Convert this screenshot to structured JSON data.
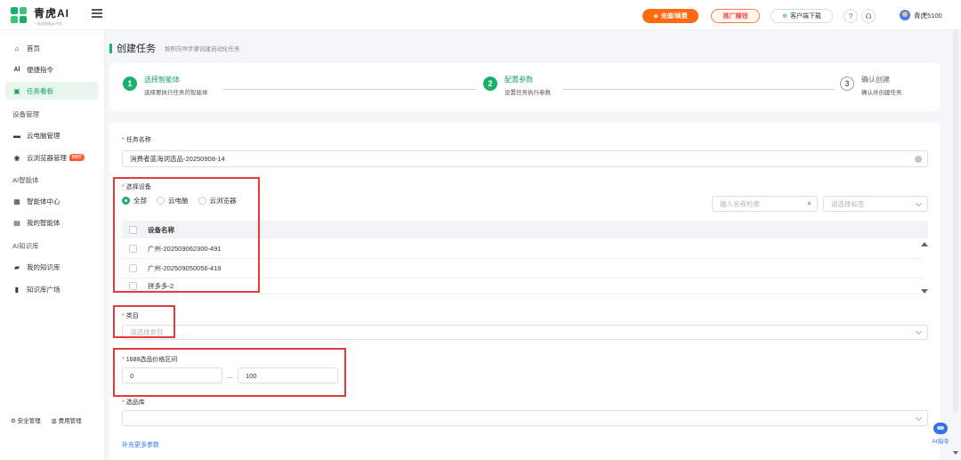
{
  "brand": {
    "name": "青虎AI",
    "tagline": "一站式电商云平台"
  },
  "header": {
    "recharge_label": "充值/续费",
    "promo_label": "推广赚钱",
    "download_label": "客户端下载",
    "user_name": "青虎5100"
  },
  "sidebar": {
    "items": [
      {
        "label": "首页",
        "icon": "home-icon"
      },
      {
        "label": "便捷指令",
        "icon": "ai-icon"
      },
      {
        "label": "任务看板",
        "icon": "board-icon",
        "active": true
      }
    ],
    "section_device": "设备管理",
    "device_items": [
      {
        "label": "云电脑管理",
        "icon": "monitor-icon"
      },
      {
        "label": "云浏览器管理",
        "icon": "browser-icon",
        "badge": "HOT"
      }
    ],
    "section_agent": "AI智能体",
    "agent_items": [
      {
        "label": "智能体中心",
        "icon": "grid-icon"
      },
      {
        "label": "我的智能体",
        "icon": "agent-icon"
      }
    ],
    "section_kb": "AI知识库",
    "kb_items": [
      {
        "label": "我的知识库",
        "icon": "folder-icon"
      },
      {
        "label": "知识库广场",
        "icon": "book-icon"
      }
    ],
    "bottom": {
      "security": "安全管理",
      "fees": "费用管理"
    }
  },
  "page": {
    "title": "创建任务",
    "subtitle": "按照向导步骤创建自动化任务"
  },
  "steps": [
    {
      "num": "1",
      "title": "选择智能体",
      "desc": "选择要执行任务的智能体",
      "state": "done"
    },
    {
      "num": "2",
      "title": "配置参数",
      "desc": "设置任务执行参数",
      "state": "active"
    },
    {
      "num": "3",
      "title": "确认创建",
      "desc": "确认并创建任务",
      "state": "pending"
    }
  ],
  "form": {
    "task_name": {
      "label": "任务名称",
      "value": "消费者蓝海词选品-20250908-14"
    },
    "device": {
      "label": "选择设备",
      "options": [
        "全部",
        "云电脑",
        "云浏览器"
      ],
      "selected": "全部",
      "search_placeholder": "输入名称检索",
      "tag_placeholder": "请选择标签",
      "column_header": "设备名称",
      "rows": [
        "广州-202509062300-491",
        "广州-202509050056-419",
        "拼多多-2"
      ]
    },
    "category": {
      "label": "类目",
      "placeholder": "请选择类目"
    },
    "price_range": {
      "label": "1688选品价格区间",
      "min": "0",
      "max": "100",
      "separator": "—"
    },
    "selection_lib": {
      "label": "选品库"
    },
    "more_link": "补充更多参数"
  },
  "ai_fab": {
    "label": "AI指令"
  },
  "colors": {
    "accent": "#19b06b",
    "highlight": "#e8393a",
    "recharge": "#ff6a13"
  }
}
